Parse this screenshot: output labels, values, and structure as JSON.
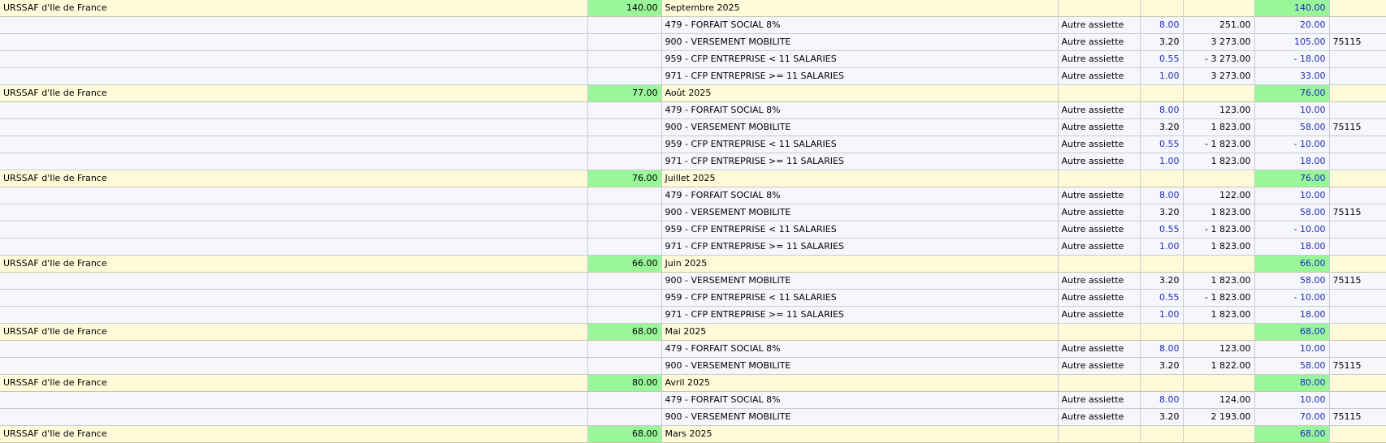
{
  "colors": {
    "group_row_bg": "#fffbd9",
    "detail_row_bg": "#f6f7fd",
    "total_cell_bg": "#99f699",
    "blue_value_text": "#1f2bbd",
    "grid_line": "#c9cbd4"
  },
  "rows": [
    {
      "type": "group",
      "organism": "URSSAF d'Ile de France",
      "total": "140.00",
      "label": "Septembre 2025",
      "amount": "140.00"
    },
    {
      "type": "detail",
      "label": "479 - FORFAIT SOCIAL 8%",
      "basis": "Autre assiette",
      "rate": "8.00",
      "rate_blue": true,
      "base": "251.00",
      "amount": "20.00",
      "code": ""
    },
    {
      "type": "detail",
      "label": "900 - VERSEMENT MOBILITE",
      "basis": "Autre assiette",
      "rate": "3.20",
      "rate_blue": false,
      "base": "3 273.00",
      "amount": "105.00",
      "code": "75115"
    },
    {
      "type": "detail",
      "label": "959 - CFP ENTREPRISE < 11 SALARIES",
      "basis": "Autre assiette",
      "rate": "0.55",
      "rate_blue": true,
      "base": "- 3 273.00",
      "amount": "- 18.00",
      "code": ""
    },
    {
      "type": "detail",
      "label": "971 - CFP ENTREPRISE >= 11 SALARIES",
      "basis": "Autre assiette",
      "rate": "1.00",
      "rate_blue": true,
      "base": "3 273.00",
      "amount": "33.00",
      "code": ""
    },
    {
      "type": "group",
      "organism": "URSSAF d'Ile de France",
      "total": "77.00",
      "label": "Août 2025",
      "amount": "76.00"
    },
    {
      "type": "detail",
      "label": "479 - FORFAIT SOCIAL 8%",
      "basis": "Autre assiette",
      "rate": "8.00",
      "rate_blue": true,
      "base": "123.00",
      "amount": "10.00",
      "code": ""
    },
    {
      "type": "detail",
      "label": "900 - VERSEMENT MOBILITE",
      "basis": "Autre assiette",
      "rate": "3.20",
      "rate_blue": false,
      "base": "1 823.00",
      "amount": "58.00",
      "code": "75115"
    },
    {
      "type": "detail",
      "label": "959 - CFP ENTREPRISE < 11 SALARIES",
      "basis": "Autre assiette",
      "rate": "0.55",
      "rate_blue": true,
      "base": "- 1 823.00",
      "amount": "- 10.00",
      "code": ""
    },
    {
      "type": "detail",
      "label": "971 - CFP ENTREPRISE >= 11 SALARIES",
      "basis": "Autre assiette",
      "rate": "1.00",
      "rate_blue": true,
      "base": "1 823.00",
      "amount": "18.00",
      "code": ""
    },
    {
      "type": "group",
      "organism": "URSSAF d'Ile de France",
      "total": "76.00",
      "label": "Juillet 2025",
      "amount": "76.00"
    },
    {
      "type": "detail",
      "label": "479 - FORFAIT SOCIAL 8%",
      "basis": "Autre assiette",
      "rate": "8.00",
      "rate_blue": true,
      "base": "122.00",
      "amount": "10.00",
      "code": ""
    },
    {
      "type": "detail",
      "label": "900 - VERSEMENT MOBILITE",
      "basis": "Autre assiette",
      "rate": "3.20",
      "rate_blue": false,
      "base": "1 823.00",
      "amount": "58.00",
      "code": "75115"
    },
    {
      "type": "detail",
      "label": "959 - CFP ENTREPRISE < 11 SALARIES",
      "basis": "Autre assiette",
      "rate": "0.55",
      "rate_blue": true,
      "base": "- 1 823.00",
      "amount": "- 10.00",
      "code": ""
    },
    {
      "type": "detail",
      "label": "971 - CFP ENTREPRISE >= 11 SALARIES",
      "basis": "Autre assiette",
      "rate": "1.00",
      "rate_blue": true,
      "base": "1 823.00",
      "amount": "18.00",
      "code": ""
    },
    {
      "type": "group",
      "organism": "URSSAF d'Ile de France",
      "total": "66.00",
      "label": "Juin 2025",
      "amount": "66.00"
    },
    {
      "type": "detail",
      "label": "900 - VERSEMENT MOBILITE",
      "basis": "Autre assiette",
      "rate": "3.20",
      "rate_blue": false,
      "base": "1 823.00",
      "amount": "58.00",
      "code": "75115"
    },
    {
      "type": "detail",
      "label": "959 - CFP ENTREPRISE < 11 SALARIES",
      "basis": "Autre assiette",
      "rate": "0.55",
      "rate_blue": true,
      "base": "- 1 823.00",
      "amount": "- 10.00",
      "code": ""
    },
    {
      "type": "detail",
      "label": "971 - CFP ENTREPRISE >= 11 SALARIES",
      "basis": "Autre assiette",
      "rate": "1.00",
      "rate_blue": true,
      "base": "1 823.00",
      "amount": "18.00",
      "code": ""
    },
    {
      "type": "group",
      "organism": "URSSAF d'Ile de France",
      "total": "68.00",
      "label": "Mai 2025",
      "amount": "68.00"
    },
    {
      "type": "detail",
      "label": "479 - FORFAIT SOCIAL 8%",
      "basis": "Autre assiette",
      "rate": "8.00",
      "rate_blue": true,
      "base": "123.00",
      "amount": "10.00",
      "code": ""
    },
    {
      "type": "detail",
      "label": "900 - VERSEMENT MOBILITE",
      "basis": "Autre assiette",
      "rate": "3.20",
      "rate_blue": false,
      "base": "1 822.00",
      "amount": "58.00",
      "code": "75115"
    },
    {
      "type": "group",
      "organism": "URSSAF d'Ile de France",
      "total": "80.00",
      "label": "Avril 2025",
      "amount": "80.00"
    },
    {
      "type": "detail",
      "label": "479 - FORFAIT SOCIAL 8%",
      "basis": "Autre assiette",
      "rate": "8.00",
      "rate_blue": true,
      "base": "124.00",
      "amount": "10.00",
      "code": ""
    },
    {
      "type": "detail",
      "label": "900 - VERSEMENT MOBILITE",
      "basis": "Autre assiette",
      "rate": "3.20",
      "rate_blue": false,
      "base": "2 193.00",
      "amount": "70.00",
      "code": "75115"
    },
    {
      "type": "group",
      "organism": "URSSAF d'Ile de France",
      "total": "68.00",
      "label": "Mars 2025",
      "amount": "68.00"
    }
  ]
}
